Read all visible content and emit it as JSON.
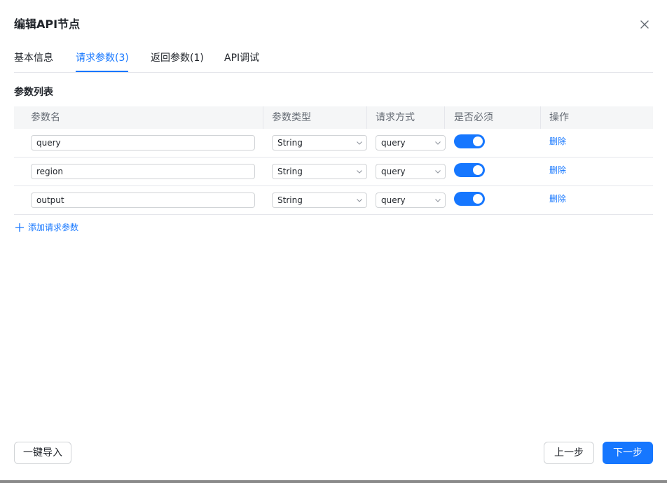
{
  "dialog": {
    "title": "编辑API节点",
    "close_icon": "close-icon"
  },
  "tabs": [
    {
      "label": "基本信息",
      "active": false
    },
    {
      "label": "请求参数(3)",
      "active": true
    },
    {
      "label": "返回参数(1)",
      "active": false
    },
    {
      "label": "API调试",
      "active": false
    }
  ],
  "section": {
    "title": "参数列表"
  },
  "table": {
    "headers": {
      "name": "参数名",
      "type": "参数类型",
      "method": "请求方式",
      "required": "是否必须",
      "actions": "操作"
    },
    "rows": [
      {
        "name": "query",
        "type": "String",
        "method": "query",
        "required": true,
        "delete_label": "删除"
      },
      {
        "name": "region",
        "type": "String",
        "method": "query",
        "required": true,
        "delete_label": "删除"
      },
      {
        "name": "output",
        "type": "String",
        "method": "query",
        "required": true,
        "delete_label": "删除"
      }
    ]
  },
  "add_param": {
    "label": "添加请求参数",
    "icon": "plus-icon"
  },
  "footer": {
    "import_label": "一键导入",
    "prev_label": "上一步",
    "next_label": "下一步"
  },
  "colors": {
    "accent": "#1677ff",
    "border": "#e5e6eb",
    "header_bg": "#f5f6f7"
  }
}
